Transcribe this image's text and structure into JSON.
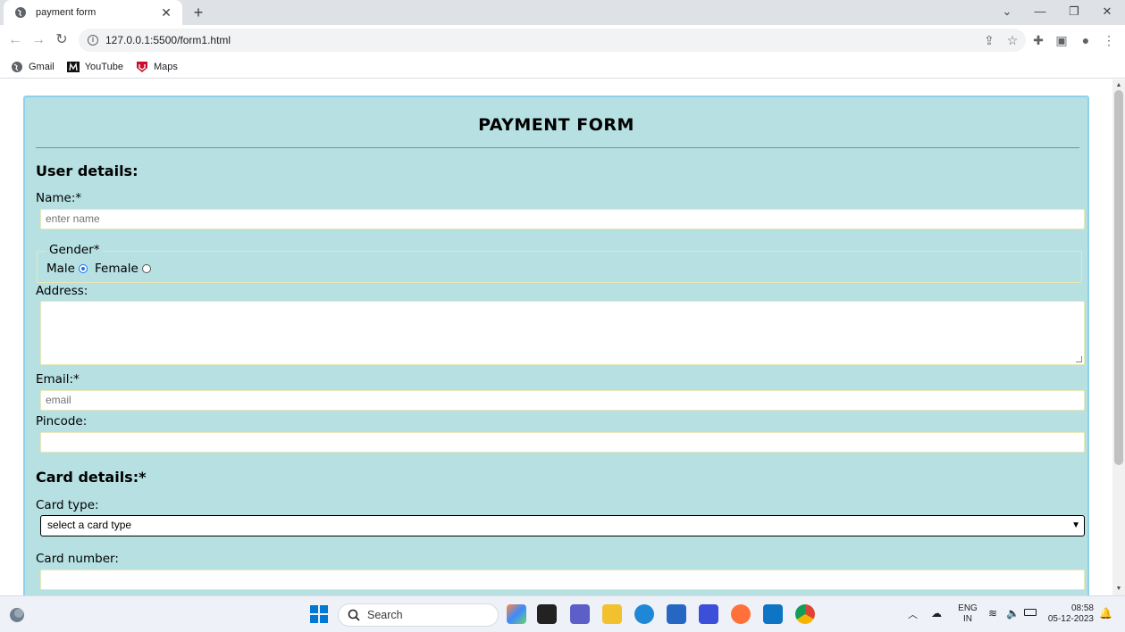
{
  "browser": {
    "tab_title": "payment form",
    "url": "127.0.0.1:5500/form1.html",
    "bookmarks": [
      {
        "label": "Gmail",
        "icon": "globe-icon"
      },
      {
        "label": "YouTube",
        "icon": "m-logo-icon"
      },
      {
        "label": "Maps",
        "icon": "shield-logo-icon"
      }
    ]
  },
  "form": {
    "title": "PAYMENT FORM",
    "user_section": "User details:",
    "name_label": "Name:*",
    "name_placeholder": "enter name",
    "gender_legend": "Gender*",
    "gender_options": [
      {
        "label": "Male",
        "checked": true
      },
      {
        "label": "Female",
        "checked": false
      }
    ],
    "address_label": "Address:",
    "email_label": "Email:*",
    "email_placeholder": "email",
    "pincode_label": "Pincode:",
    "card_section": "Card details:*",
    "card_type_label": "Card type:",
    "card_type_selected": "select a card type",
    "card_number_label": "Card number:"
  },
  "taskbar": {
    "search_label": "Search",
    "lang_line1": "ENG",
    "lang_line2": "IN",
    "time": "08:58",
    "date": "05-12-2023"
  },
  "colors": {
    "form_bg": "#b6e0e2",
    "form_border": "#8fd1ec",
    "radio_accent": "#1a73e8"
  }
}
